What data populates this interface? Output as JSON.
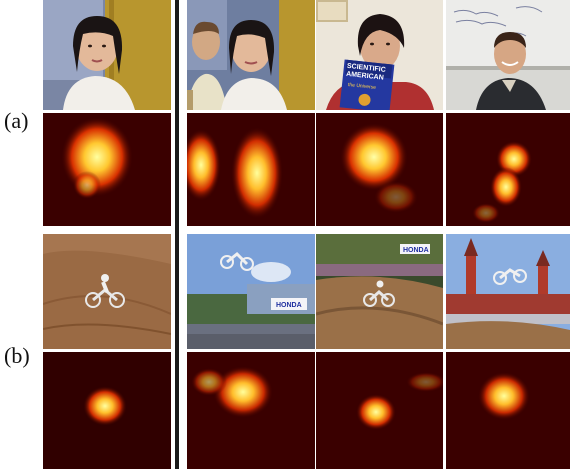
{
  "figure": {
    "panel_labels": [
      "(a)",
      "(b)"
    ],
    "panels": [
      {
        "id": "a",
        "rows": [
          {
            "kind": "video-frames",
            "items": [
              "woman-frame",
              "two-people-frame",
              "woman-magazine-frame",
              "smiling-man-frame"
            ]
          },
          {
            "kind": "saliency-heatmaps",
            "items": [
              "heatmap-a1",
              "heatmap-a2",
              "heatmap-a3",
              "heatmap-a4"
            ]
          }
        ],
        "magazine_text": {
          "line1": "SCIENTIFIC",
          "line2": "AMERICAN",
          "line3": "the Universe"
        }
      },
      {
        "id": "b",
        "rows": [
          {
            "kind": "video-frames",
            "items": [
              "motocross-dirt-frame",
              "motocross-jump-frame",
              "motocross-track-frame",
              "motocross-kremlin-frame"
            ]
          },
          {
            "kind": "saliency-heatmaps",
            "items": [
              "heatmap-b1",
              "heatmap-b2",
              "heatmap-b3",
              "heatmap-b4"
            ]
          }
        ],
        "banner_text": "HONDA"
      }
    ],
    "colors": {
      "heat_bg": "#3a0000",
      "heat_mid": "#e03c00",
      "heat_hot": "#ffe46a",
      "divider": "#1a1a1a"
    }
  }
}
